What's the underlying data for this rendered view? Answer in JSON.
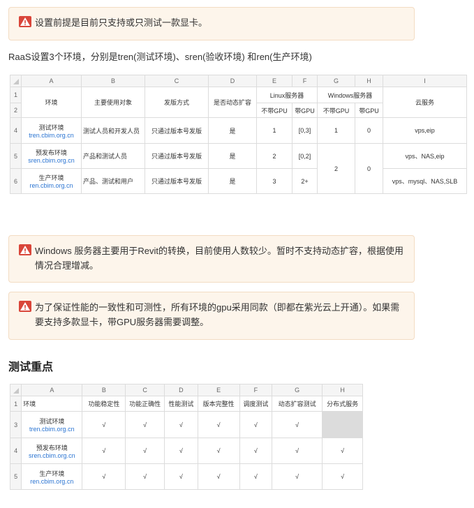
{
  "note1": {
    "text": "设置前提是目前只支持或只测试一款显卡。",
    "icon": "warning-icon"
  },
  "intro": "RaaS设置3个环境，分别是tren(测试环境)、sren(验收环境) 和ren(生产环境)",
  "table1": {
    "col_letters": [
      "A",
      "B",
      "C",
      "D",
      "E",
      "F",
      "G",
      "H",
      "I"
    ],
    "row_numbers": [
      "1",
      "2",
      "4",
      "5",
      "6"
    ],
    "headers": {
      "env": "环境",
      "target": "主要使用对象",
      "release": "发版方式",
      "scale": "是否动态扩容",
      "linux": "Linux服务器",
      "windows": "Windows服务器",
      "cloud": "云服务",
      "no_gpu": "不带GPU",
      "gpu": "带GPU"
    },
    "rows": [
      {
        "env": "测试环境",
        "link": "tren.cbim.org.cn",
        "target": "测试人员和开发人员",
        "release": "只通过版本号发版",
        "scale": "是",
        "linux_nogpu": "1",
        "linux_gpu": "[0,3]",
        "win_nogpu": "1",
        "win_gpu": "0",
        "cloud": "vps,eip"
      },
      {
        "env": "预发布环境",
        "link": "sren.cbim.org.cn",
        "target": "产品和测试人员",
        "release": "只通过版本号发版",
        "scale": "是",
        "linux_nogpu": "2",
        "linux_gpu": "[0,2]",
        "cloud": "vps、NAS,eip"
      },
      {
        "env": "生产环境",
        "link": "ren.cbim.org.cn",
        "target": "产品、测试和用户",
        "release": "只通过版本号发版",
        "scale": "是",
        "linux_nogpu": "3",
        "linux_gpu": "2+",
        "cloud": "vps、mysql、NAS,SLB"
      }
    ],
    "win_merged_nogpu": "2",
    "win_merged_gpu": "0"
  },
  "note2": {
    "text": "Windows 服务器主要用于Revit的转换，目前使用人数较少。暂时不支持动态扩容，根据使用情况合理增减。",
    "icon": "warning-icon"
  },
  "note3": {
    "text": "为了保证性能的一致性和可测性，所有环境的gpu采用同款（即都在紫光云上开通）。如果需要支持多款显卡，带GPU服务器需要调整。",
    "icon": "warning-icon"
  },
  "section_title": "测试重点",
  "table2": {
    "col_letters": [
      "A",
      "B",
      "C",
      "D",
      "E",
      "F",
      "G",
      "H"
    ],
    "row_numbers": [
      "1",
      "3",
      "4",
      "5"
    ],
    "headers": [
      "环境",
      "功能稳定性",
      "功能正确性",
      "性能测试",
      "版本完整性",
      "调度测试",
      "动态扩容测试",
      "分布式服务"
    ],
    "rows": [
      {
        "env": "测试环境",
        "link": "tren.cbim.org.cn",
        "marks": [
          "√",
          "√",
          "√",
          "√",
          "√",
          "√",
          ""
        ]
      },
      {
        "env": "预发布环境",
        "link": "sren.cbim.org.cn",
        "marks": [
          "√",
          "√",
          "√",
          "√",
          "√",
          "√",
          "√"
        ]
      },
      {
        "env": "生产环境",
        "link": "ren.cbim.org.cn",
        "marks": [
          "√",
          "√",
          "√",
          "√",
          "√",
          "√",
          "√"
        ]
      }
    ]
  },
  "colors": {
    "callout_bg": "#fdf5eb",
    "link": "#2a74d2",
    "warn_red": "#d9463a",
    "header_bg": "#f5f5f5"
  }
}
